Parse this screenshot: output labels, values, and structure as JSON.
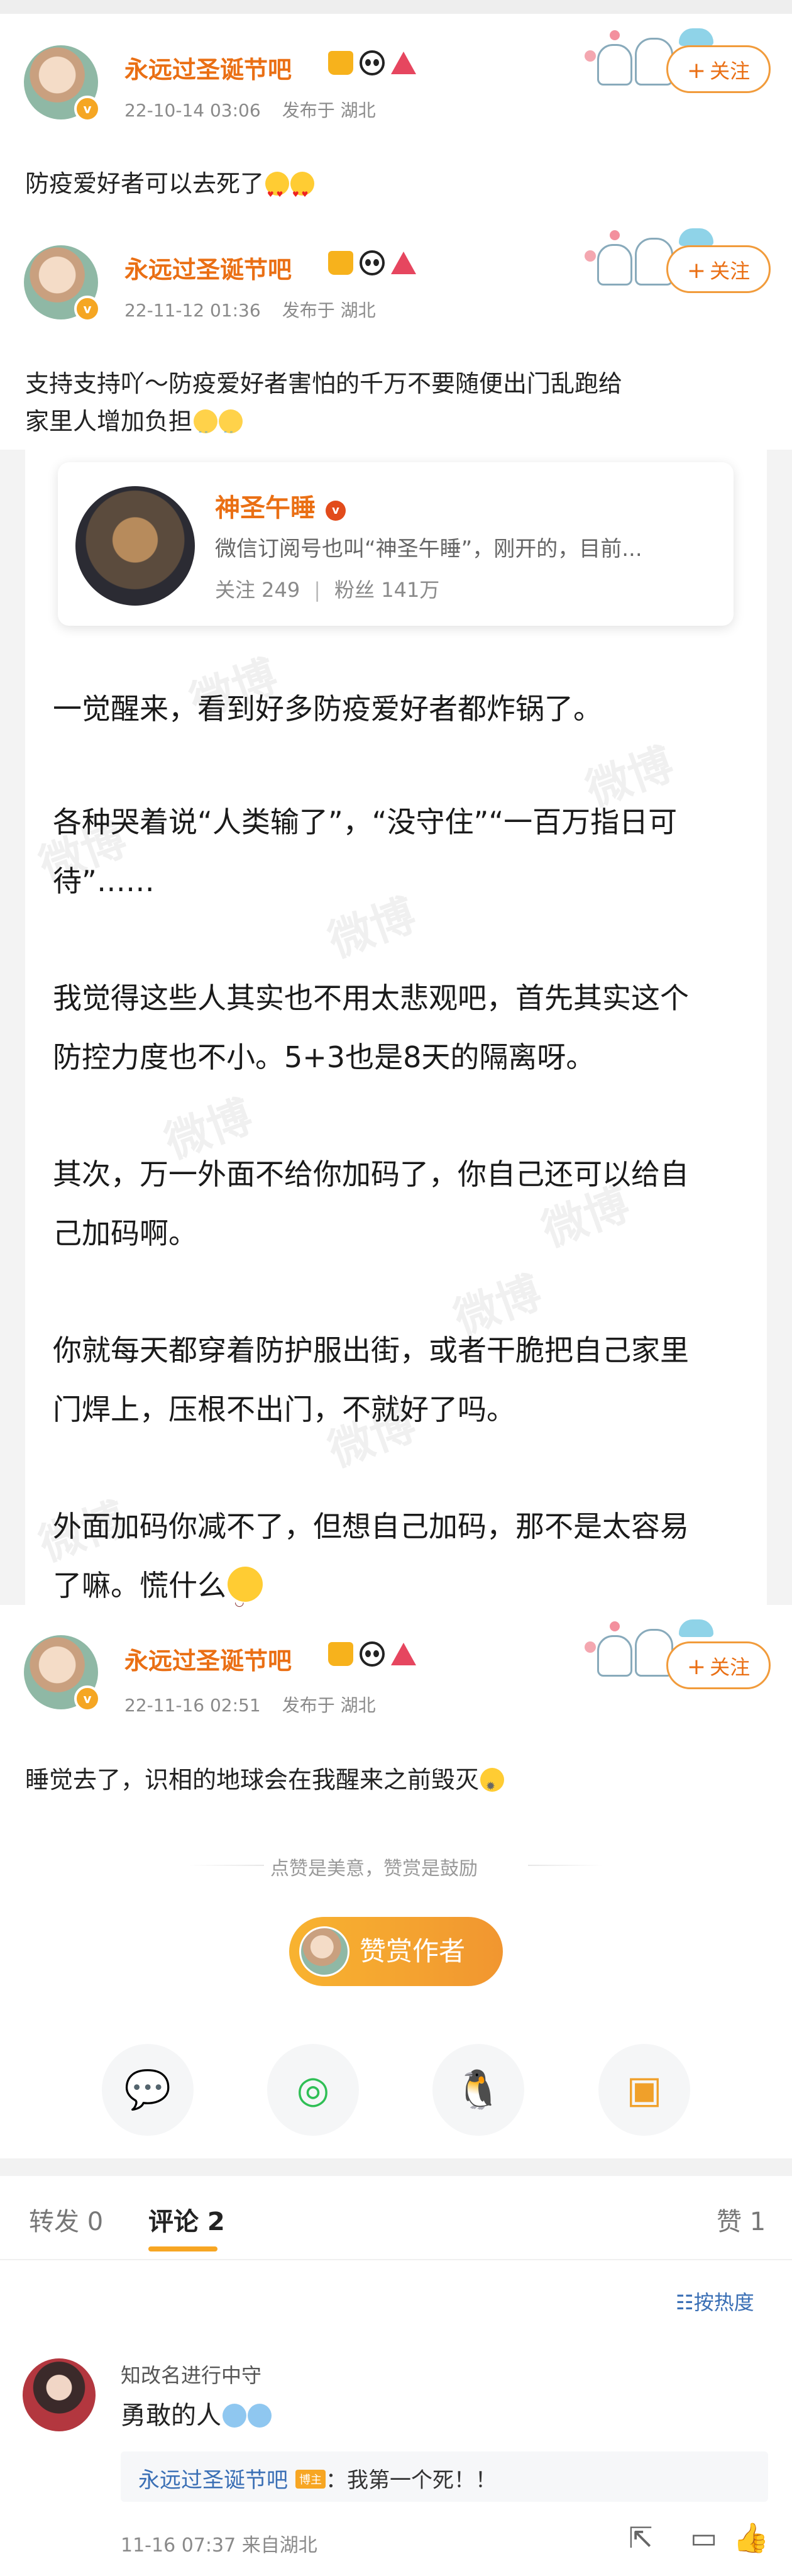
{
  "posts": [
    {
      "name": "永远过圣诞节吧",
      "date": "22-10-14 03:06",
      "location": "发布于 湖北",
      "text": "防疫爱好者可以去死了",
      "follow": "关注",
      "vbadge": "v"
    },
    {
      "name": "永远过圣诞节吧",
      "date": "22-11-12 01:36",
      "location": "发布于 湖北",
      "text_line1": "支持支持吖～防疫爱好者害怕的千万不要随便出门乱跑给",
      "text_line2": "家里人增加负担",
      "follow": "关注",
      "vbadge": "v"
    },
    {
      "name": "永远过圣诞节吧",
      "date": "22-11-16 02:51",
      "location": "发布于 湖北",
      "text": "睡觉去了，识相的地球会在我醒来之前毁灭",
      "follow": "关注",
      "vbadge": "v"
    }
  ],
  "repost_card": {
    "name": "神圣午睡",
    "description": "微信订阅号也叫“神圣午睡”，刚开的，目前...",
    "follows": "关注 249",
    "fans": "粉丝 141万"
  },
  "article": [
    "一觉醒来，看到好多防疫爱好者都炸锅了。",
    "各种哭着说“人类输了”，“没守住”“一百万指日可",
    "待”……",
    "我觉得这些人其实也不用太悲观吧，首先其实这个",
    "防控力度也不小。5+3也是8天的隔离呀。",
    "其次，万一外面不给你加码了，你自己还可以给自",
    "己加码啊。",
    "你就每天都穿着防护服出街，或者干脆把自己家里",
    "门焊上，压根不出门，不就好了吗。",
    "外面加码你减不了，但想自己加码，那不是太容易",
    "了嘛。慌什么"
  ],
  "reward": {
    "divider_text": "点赞是美意，赞赏是鼓励",
    "button": "赞赏作者"
  },
  "tabs": {
    "repost": "转发 0",
    "comments": "评论 2",
    "likes": "赞 1"
  },
  "sort_label": "按热度",
  "comment": {
    "name": "知改名进行中守",
    "text": "勇敢的人",
    "reply_name": "永远过圣诞节吧",
    "reply_badge": "博主",
    "reply_text": "：我第一个死！！",
    "meta": "11-16 07:37  来自湖北"
  },
  "watermark": "微博",
  "colors": {
    "accent": "#ea6f14",
    "follow_border": "#f19b3b",
    "link": "#3a6fb5",
    "reward": "#f7a623"
  }
}
